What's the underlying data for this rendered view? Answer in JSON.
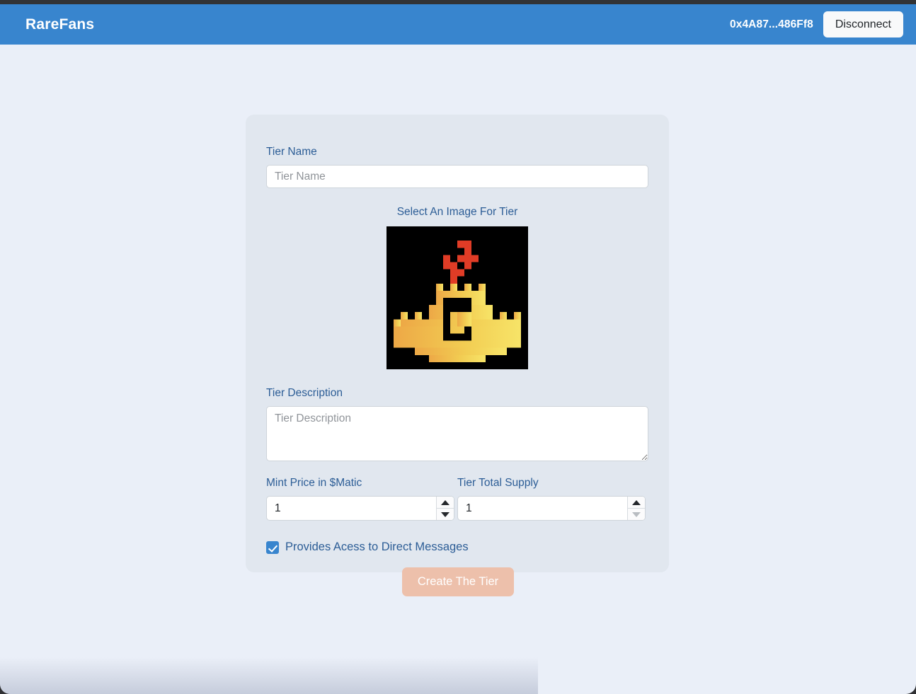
{
  "navbar": {
    "brand": "RareFans",
    "wallet_address": "0x4A87...486Ff8",
    "disconnect_label": "Disconnect",
    "bg_color": "#3885ce"
  },
  "form": {
    "tier_name": {
      "label": "Tier Name",
      "placeholder": "Tier Name",
      "value": ""
    },
    "image": {
      "label": "Select An Image For Tier",
      "alt": "pixel-art castle with red flag and letter C",
      "background": "#000000",
      "castle_colors": [
        "#f0b94b",
        "#f6e06a"
      ],
      "flag_color": "#e03c26"
    },
    "tier_description": {
      "label": "Tier Description",
      "placeholder": "Tier Description",
      "value": ""
    },
    "mint_price": {
      "label": "Mint Price in $Matic",
      "value": "1",
      "step_up": "▲",
      "step_down": "▼",
      "step_down_disabled": false
    },
    "total_supply": {
      "label": "Tier Total Supply",
      "value": "1",
      "step_up": "▲",
      "step_down": "▼",
      "step_down_disabled": true
    },
    "dm_access": {
      "label": "Provides Acess to Direct Messages",
      "checked": true
    },
    "submit": {
      "label": "Create The Tier",
      "disabled": true,
      "color": "#edc0ab"
    },
    "card_color": "#e1e7ef",
    "label_color": "#2c5d96"
  },
  "page": {
    "background": "#eaeff8"
  }
}
